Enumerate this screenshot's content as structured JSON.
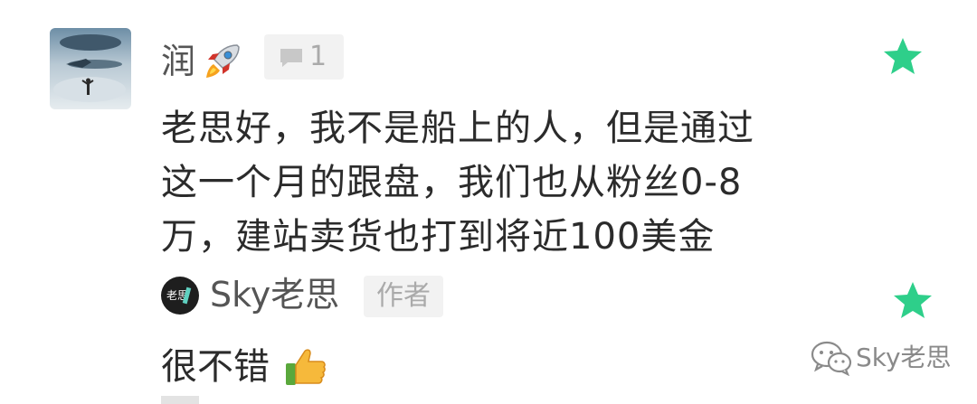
{
  "comment": {
    "username": "润",
    "reply_count": "1",
    "lines": [
      "老思好，我不是船上的人，但是通过",
      "这一个月的跟盘，我们也从粉丝0-8",
      "万，建站卖货也打到将近100美金"
    ]
  },
  "reply": {
    "author_name": "Sky老思",
    "author_badge": "作者",
    "text": "很不错"
  },
  "watermark": {
    "text": "Sky老思"
  },
  "icons": {
    "star": "star-icon",
    "rocket": "rocket-icon",
    "reply_bubble": "comment-bubble-icon",
    "thumbs": "thumbs-up-icon",
    "wechat": "wechat-icon"
  },
  "colors": {
    "star": "#2ecf8a",
    "text": "#2b2b2b",
    "name": "#555555",
    "badge_bg": "#f2f2f2"
  }
}
